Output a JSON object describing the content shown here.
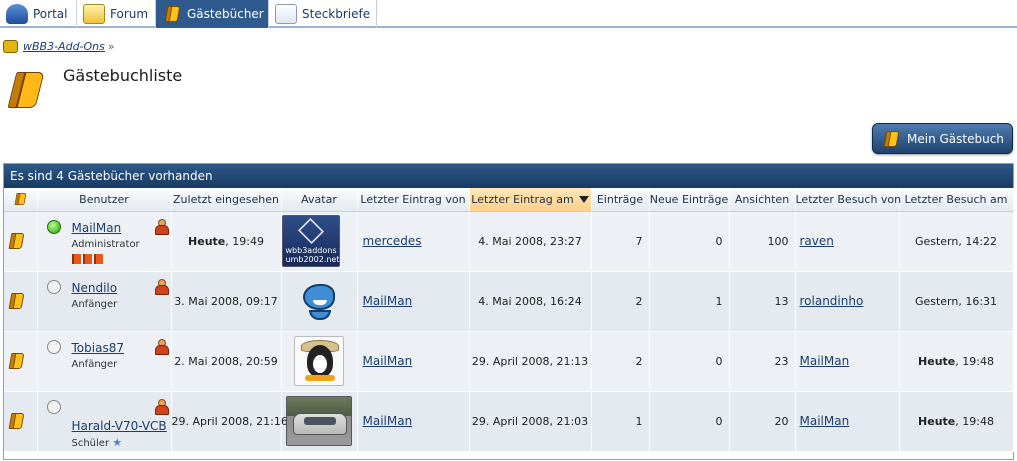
{
  "tabs": [
    {
      "label": "Portal",
      "icon": "portal-icon",
      "active": false
    },
    {
      "label": "Forum",
      "icon": "forum-icon",
      "active": false
    },
    {
      "label": "Gästebücher",
      "icon": "guestbook-icon",
      "active": true
    },
    {
      "label": "Steckbriefe",
      "icon": "profile-card-icon",
      "active": false
    }
  ],
  "breadcrumb": {
    "link": "wBB3-Add-Ons",
    "sep": "»"
  },
  "page": {
    "title": "Gästebuchliste"
  },
  "my_guestbook_button": "Mein Gästebuch",
  "table": {
    "caption": "Es sind 4 Gästebücher vorhanden",
    "headers": [
      "Benutzer",
      "Zuletzt eingesehen",
      "Avatar",
      "Letzter Eintrag von",
      "Letzter Eintrag am",
      "Einträge",
      "Neue Einträge",
      "Ansichten",
      "Letzter Besuch von",
      "Letzter Besuch am"
    ],
    "sorted_column": "Letzter Eintrag am",
    "rows": [
      {
        "user": "MailMan",
        "rank": "Administrator",
        "online": true,
        "last_viewed_bold": "Heute",
        "last_viewed_rest": ", 19:49",
        "avatar_text": "wbb3addons umb2002.net",
        "last_entry_by": "mercedes",
        "last_entry_at": "4. Mai 2008, 23:27",
        "entries": "7",
        "new_entries": "0",
        "views": "100",
        "last_visit_by": "raven",
        "last_visit_bold": "Gestern",
        "last_visit_rest": ", 14:22"
      },
      {
        "user": "Nendilo",
        "rank": "Anfänger",
        "online": false,
        "last_viewed_bold": "",
        "last_viewed_rest": "3. Mai 2008, 09:17",
        "avatar_text": "",
        "last_entry_by": "MailMan",
        "last_entry_at": "4. Mai 2008, 16:24",
        "entries": "2",
        "new_entries": "1",
        "views": "13",
        "last_visit_by": "rolandinho",
        "last_visit_bold": "Gestern",
        "last_visit_rest": ", 16:31"
      },
      {
        "user": "Tobias87",
        "rank": "Anfänger",
        "online": false,
        "last_viewed_bold": "",
        "last_viewed_rest": "2. Mai 2008, 20:59",
        "avatar_text": "",
        "last_entry_by": "MailMan",
        "last_entry_at": "29. April 2008, 21:13",
        "entries": "2",
        "new_entries": "0",
        "views": "23",
        "last_visit_by": "MailMan",
        "last_visit_bold": "Heute",
        "last_visit_rest": ", 19:48"
      },
      {
        "user": "Harald-V70-VCB",
        "rank": "Schüler",
        "online": false,
        "last_viewed_bold": "",
        "last_viewed_rest": "29. April 2008, 21:16",
        "avatar_text": "",
        "last_entry_by": "MailMan",
        "last_entry_at": "29. April 2008, 21:03",
        "entries": "1",
        "new_entries": "0",
        "views": "20",
        "last_visit_by": "MailMan",
        "last_visit_bold": "Heute",
        "last_visit_rest": ", 19:48"
      }
    ]
  }
}
